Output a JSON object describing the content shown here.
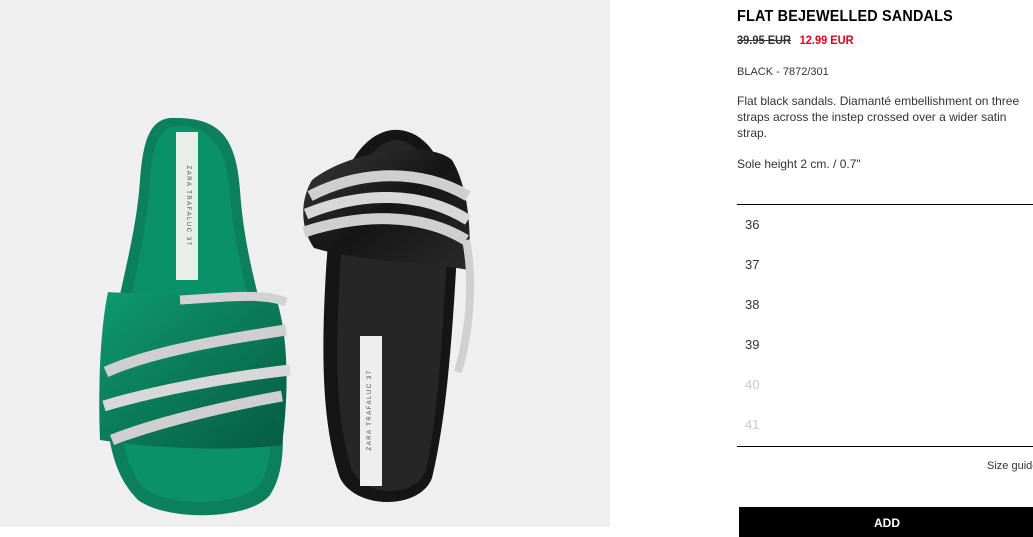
{
  "product": {
    "title": "FLAT BEJEWELLED SANDALS",
    "old_price": "39.95 EUR",
    "new_price": "12.99 EUR",
    "color_ref": "BLACK - 7872/301",
    "description": "Flat black sandals. Diamanté embellishment on three straps across the instep crossed over a wider satin strap.",
    "sole_height": "Sole height 2 cm. / 0.7\"",
    "image_label_green": "ZARA TRAFALUC 37",
    "image_label_black": "ZARA TRAFALUC 37"
  },
  "sizes": [
    {
      "label": "36",
      "available": true
    },
    {
      "label": "37",
      "available": true
    },
    {
      "label": "38",
      "available": true
    },
    {
      "label": "39",
      "available": true
    },
    {
      "label": "40",
      "available": false
    },
    {
      "label": "41",
      "available": false
    }
  ],
  "size_guide": "Size guide",
  "add_button": "ADD",
  "colors": {
    "sale_price": "#e3001b",
    "image_bg": "#efefef",
    "green_sandal": "#0d8a63",
    "black_sandal": "#1b1b1b"
  }
}
